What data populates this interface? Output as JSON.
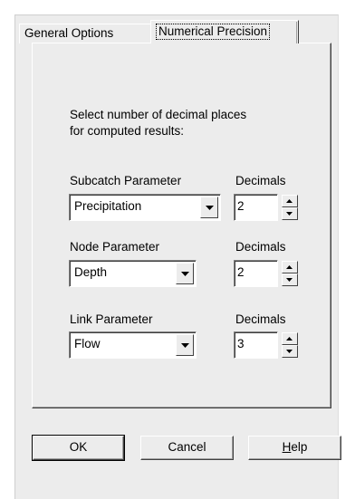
{
  "tabs": {
    "general": "General Options",
    "numerical": "Numerical Precision"
  },
  "instructions": {
    "line1": "Select number of decimal places",
    "line2": "for computed results:"
  },
  "rows": [
    {
      "param_label": "Subcatch Parameter",
      "decimals_label": "Decimals",
      "selected": "Precipitation",
      "decimals": "2"
    },
    {
      "param_label": "Node Parameter",
      "decimals_label": "Decimals",
      "selected": "Depth",
      "decimals": "2"
    },
    {
      "param_label": "Link Parameter",
      "decimals_label": "Decimals",
      "selected": "Flow",
      "decimals": "3"
    }
  ],
  "buttons": {
    "ok": "OK",
    "cancel": "Cancel",
    "help_mnemonic": "H",
    "help_rest": "elp"
  },
  "icons": {
    "dropdown": "chevron-down-icon",
    "spin_up": "arrow-up-icon",
    "spin_down": "arrow-down-icon"
  }
}
